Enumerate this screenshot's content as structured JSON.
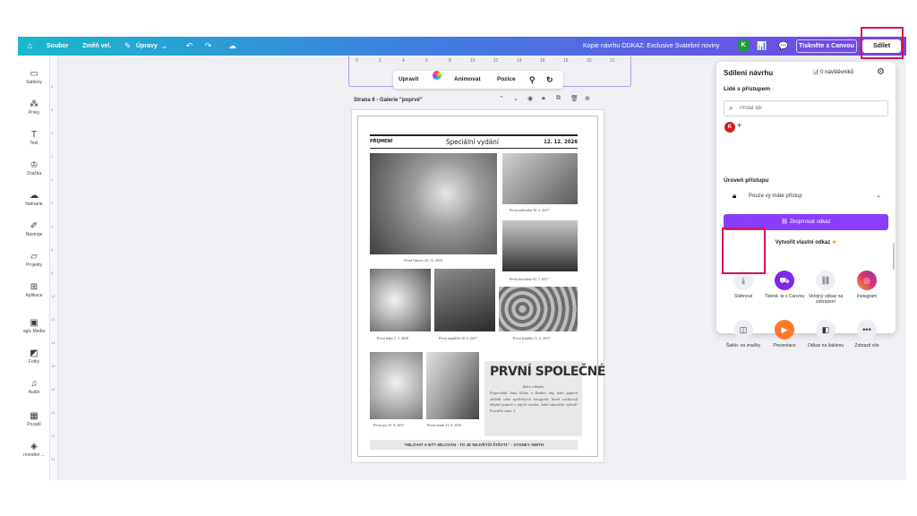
{
  "topbar": {
    "file": "Soubor",
    "resize": "Změň vel.",
    "edits": "Úpravy",
    "design_title": "Kopie návrhu  ODKAZ: Exclusive Svatební noviny",
    "avatar_initial": "K",
    "print_button": "Tiskněte s Canvou",
    "share_button": "Sdílet",
    "icons": [
      "home-icon",
      "pencil-icon",
      "chevron-down-icon",
      "undo-icon",
      "redo-icon",
      "cloud-check-icon",
      "analytics-icon",
      "comment-icon"
    ]
  },
  "sidebar": {
    "items": [
      {
        "label": "Šablony",
        "icon": "templates-icon"
      },
      {
        "label": "Prvky",
        "icon": "elements-icon"
      },
      {
        "label": "Text",
        "icon": "text-icon"
      },
      {
        "label": "Značka",
        "icon": "brand-icon"
      },
      {
        "label": "Nahrané",
        "icon": "upload-icon"
      },
      {
        "label": "Nástroje",
        "icon": "draw-icon"
      },
      {
        "label": "Projekty",
        "icon": "folder-icon"
      },
      {
        "label": "Aplikace",
        "icon": "apps-icon"
      },
      {
        "label": "agic Media",
        "icon": "magic-media-icon"
      },
      {
        "label": "Fotky",
        "icon": "photos-icon"
      },
      {
        "label": "Audio",
        "icon": "audio-icon"
      },
      {
        "label": "Pozadí",
        "icon": "background-icon"
      },
      {
        "label": "revodné ...",
        "icon": "convert-icon"
      }
    ]
  },
  "ruler": {
    "h_ticks": [
      "0",
      "2",
      "4",
      "6",
      "8",
      "10",
      "12",
      "14",
      "16",
      "18",
      "20",
      "22"
    ],
    "v_ticks": [
      "8",
      "6",
      "4",
      "2",
      "0",
      "2",
      "4",
      "6",
      "8",
      "10",
      "12",
      "14",
      "16",
      "18",
      "20",
      "22",
      "24",
      "26"
    ]
  },
  "floating_toolbar": {
    "edit": "Upravit",
    "animate": "Animovat",
    "position": "Pozice"
  },
  "page_header": {
    "label": "Strana 6 - Galerie \"poprvé\""
  },
  "newspaper": {
    "left_head": "PŘÍJMENÍ",
    "center_head": "Speciální vydání",
    "right_head": "12. 12. 2026",
    "captions": {
      "c1": "První Vánoce 24. 12. 2016",
      "c2": "První stěhování 30. 2. 2017",
      "c3": "První dovolená 30. 7. 2017",
      "c4": "První bábo 2. 3. 2018",
      "c5": "První mazlíček 18. 5. 2017",
      "c6": "První koláčky 31. 5. 2017",
      "c7": "První pes 10. 9. 2017",
      "c8": "První rande 21. 6. 2016"
    },
    "story_title": "PRVNÍ SPOLEČNÉ",
    "story_subtitle": "Klára a Radim",
    "story_text": "Popovídali Jana Klára a Radim aby nám poprvé zdobili sebe společných fotografií. které zachycují nějaké poprvé v jejich vztahu...Jaké zázračný vyhrál? Posuďte sami :)",
    "quote": "\"MILOVAT A BÝT MILOVÁN - TO JE NEJVĚTŠÍ ŠTĚSTÍ.\" - SYDNEY SMITH"
  },
  "share_panel": {
    "title": "Sdílení návrhu",
    "visitors": "0 návštěvníků",
    "people_label": "Lidé s přístupem",
    "add_people_placeholder": "Přidat lidi",
    "avatar_initial": "K",
    "access_level_label": "Úroveň přístupu",
    "access_value": "Pouze vy máte přístup",
    "copy_link": "Zkopírovat odkaz",
    "custom_link": "Vytvořit vlastní odkaz",
    "tiles": [
      {
        "label": "Stáhnout",
        "icon": "download-icon"
      },
      {
        "label": "Tiskně- te s Canvou",
        "icon": "print-truck-icon"
      },
      {
        "label": "Veřejný odkaz na zobrazení",
        "icon": "link-icon"
      },
      {
        "label": "Instagram",
        "icon": "instagram-icon"
      },
      {
        "label": "Šablo- na značky",
        "icon": "brand-template-icon"
      },
      {
        "label": "Prezentace",
        "icon": "presentation-icon"
      },
      {
        "label": "Odkaz na šablonu",
        "icon": "template-link-icon"
      },
      {
        "label": "Zobrazit vše",
        "icon": "more-icon"
      }
    ]
  },
  "colors": {
    "accent_purple": "#8b3dff",
    "highlight_red": "#d4145a",
    "avatar_green": "#1f9d3a",
    "avatar_red": "#d41d1d",
    "instagram_orange": "#f97a2b",
    "print_purple": "#7d2ae8"
  }
}
